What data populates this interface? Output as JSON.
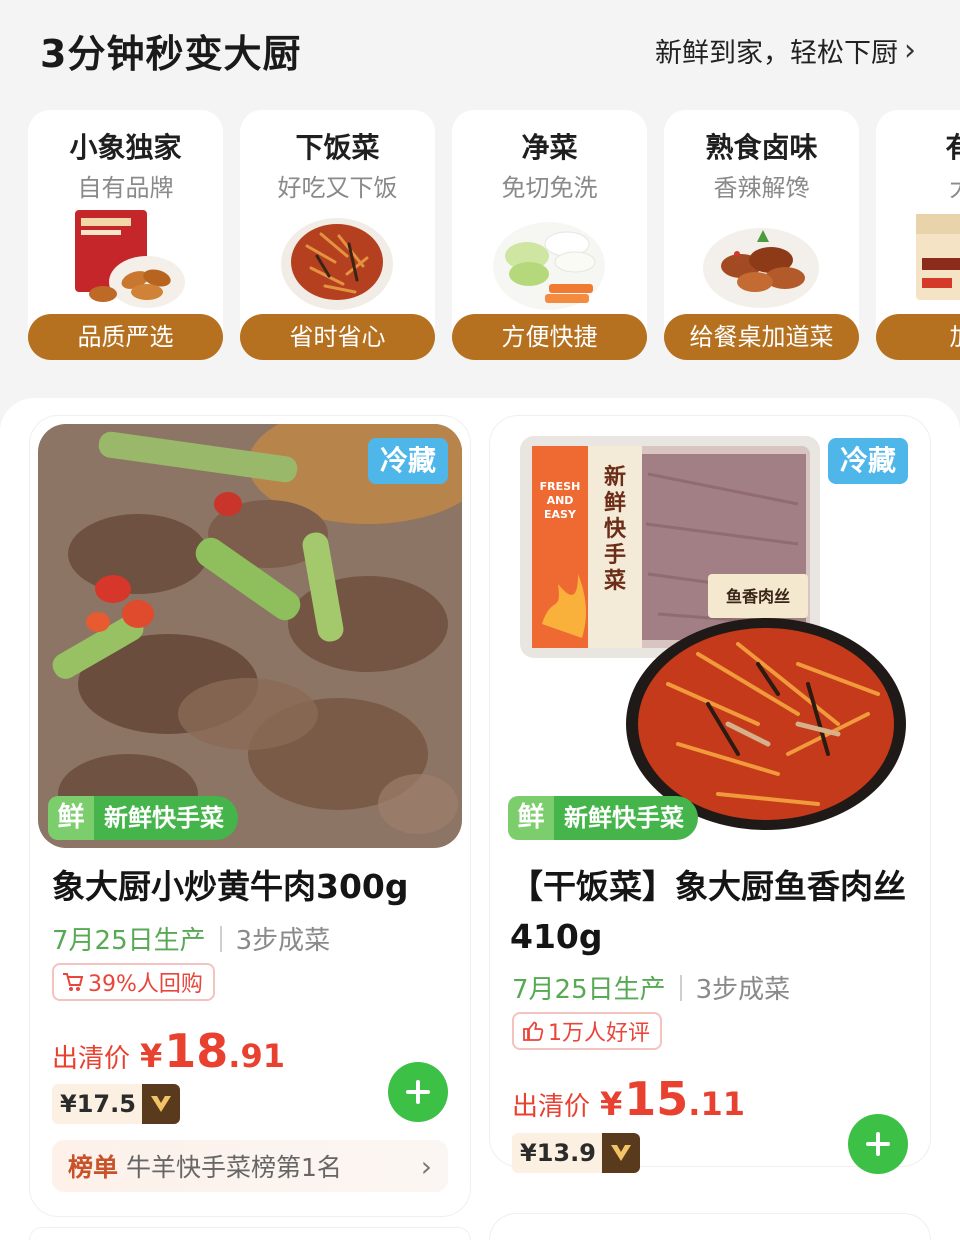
{
  "header": {
    "title": "3分钟秒变大厨",
    "link_text": "新鲜到家，轻松下厨"
  },
  "categories": [
    {
      "title": "小象独家",
      "subtitle": "自有品牌",
      "pill": "品质严选",
      "image": "packaged-chicken-wings"
    },
    {
      "title": "下饭菜",
      "subtitle": "好吃又下饭",
      "pill": "省时省心",
      "image": "shredded-pork-dish"
    },
    {
      "title": "净菜",
      "subtitle": "免切免洗",
      "pill": "方便快捷",
      "image": "sliced-vegetables"
    },
    {
      "title": "熟食卤味",
      "subtitle": "香辣解馋",
      "pill": "给餐桌加道菜",
      "image": "braised-meat-plate"
    },
    {
      "title": "有料",
      "subtitle": "大厨",
      "pill": "加餐",
      "image": "packaged-food-box"
    }
  ],
  "products": [
    {
      "cold_badge": "冷藏",
      "fresh_badge_char": "鲜",
      "fresh_badge_text": "新鲜快手菜",
      "title_line1": "象大厨小炒黄牛肉300g",
      "title_line2": "",
      "date": "7月25日生产",
      "steps": "3步成菜",
      "tag": "39%人回购",
      "tag_icon": "cart-icon",
      "price_label": "出清价",
      "price_yen": "¥",
      "price_int": "18",
      "price_dec": ".91",
      "member_price": "¥17.5",
      "rank_label": "榜单",
      "rank_text": "牛羊快手菜榜第1名"
    },
    {
      "cold_badge": "冷藏",
      "fresh_badge_char": "鲜",
      "fresh_badge_text": "新鲜快手菜",
      "title_line1": "【干饭菜】象大厨鱼香肉丝",
      "title_line2": "410g",
      "date": "7月25日生产",
      "steps": "3步成菜",
      "tag": "1万人好评",
      "tag_icon": "thumbs-up-icon",
      "price_label": "出清价",
      "price_yen": "¥",
      "price_int": "15",
      "price_dec": ".11",
      "member_price": "¥13.9",
      "package_text": "新鲜快手菜",
      "package_side": "FRESH AND EASY",
      "package_label": "鱼香肉丝"
    }
  ],
  "colors": {
    "pill": "#b5711f",
    "price": "#e8412f",
    "green": "#3cc046",
    "cold_badge": "#4fb6ea"
  }
}
